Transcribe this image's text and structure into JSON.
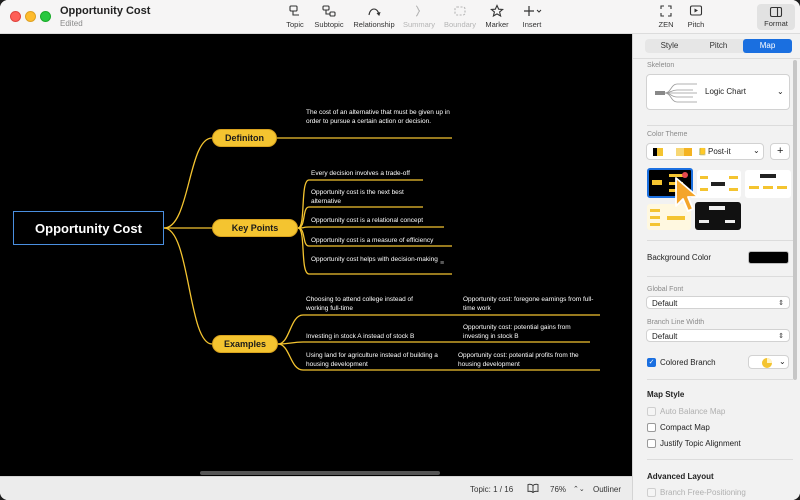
{
  "window": {
    "title": "Opportunity Cost",
    "subtitle": "Edited"
  },
  "toolbar": {
    "tools": [
      {
        "label": "Topic",
        "icon": "topic-icon",
        "disabled": false
      },
      {
        "label": "Subtopic",
        "icon": "subtopic-icon",
        "disabled": false
      },
      {
        "label": "Relationship",
        "icon": "relationship-icon",
        "disabled": false
      },
      {
        "label": "Summary",
        "icon": "summary-icon",
        "disabled": true
      },
      {
        "label": "Boundary",
        "icon": "boundary-icon",
        "disabled": true
      },
      {
        "label": "Marker",
        "icon": "marker-icon",
        "disabled": false
      },
      {
        "label": "Insert",
        "icon": "insert-icon",
        "disabled": false
      }
    ],
    "zen": "ZEN",
    "pitch": "Pitch",
    "format": "Format"
  },
  "map": {
    "root": "Opportunity Cost",
    "branches": {
      "definition": {
        "label": "Definiton",
        "leaf": "The cost of an alternative that must be given up in order to pursue a certain action or decision."
      },
      "key_points": {
        "label": "Key Points",
        "leaves": [
          "Every decision involves a trade-off",
          "Opportunity cost is the next best alternative",
          "Opportunity cost is a relational concept",
          "Opportunity cost is a measure of efficiency",
          "Opportunity cost helps with decision-making"
        ]
      },
      "examples": {
        "label": "Examples",
        "items": [
          {
            "text": "Choosing to attend college instead of working full-time",
            "detail": "Opportunity cost: foregone earnings from full-time work"
          },
          {
            "text": "Investing in stock A instead of stock B",
            "detail": "Opportunity cost: potential gains from investing in stock B"
          },
          {
            "text": "Using land for agriculture instead of building a housing development",
            "detail": "Opportunity cost: potential profits from the housing development"
          }
        ]
      }
    },
    "colors": {
      "background": "#000000",
      "branch_fill": "#f4c430",
      "branch_line": "#f4c430",
      "root_border": "#4a8fe0"
    }
  },
  "statusbar": {
    "topic": "Topic: 1 / 16",
    "zoom": "76%",
    "outliner": "Outliner"
  },
  "panel": {
    "tabs": [
      "Style",
      "Pitch",
      "Map"
    ],
    "active_tab": "Map",
    "skeleton_label": "Skeleton",
    "skeleton_value": "Logic Chart",
    "color_theme_label": "Color Theme",
    "color_theme_value": "Post-it",
    "add_symbol": "+",
    "background_color_label": "Background Color",
    "background_color_value": "#000000",
    "global_font_label": "Global Font",
    "global_font_value": "Default",
    "branch_line_width_label": "Branch Line Width",
    "branch_line_width_value": "Default",
    "colored_branch_label": "Colored Branch",
    "map_style_label": "Map Style",
    "auto_balance": "Auto Balance Map",
    "compact_map": "Compact Map",
    "justify": "Justify Topic Alignment",
    "advanced_layout_label": "Advanced Layout",
    "branch_free": "Branch Free-Positioning"
  }
}
